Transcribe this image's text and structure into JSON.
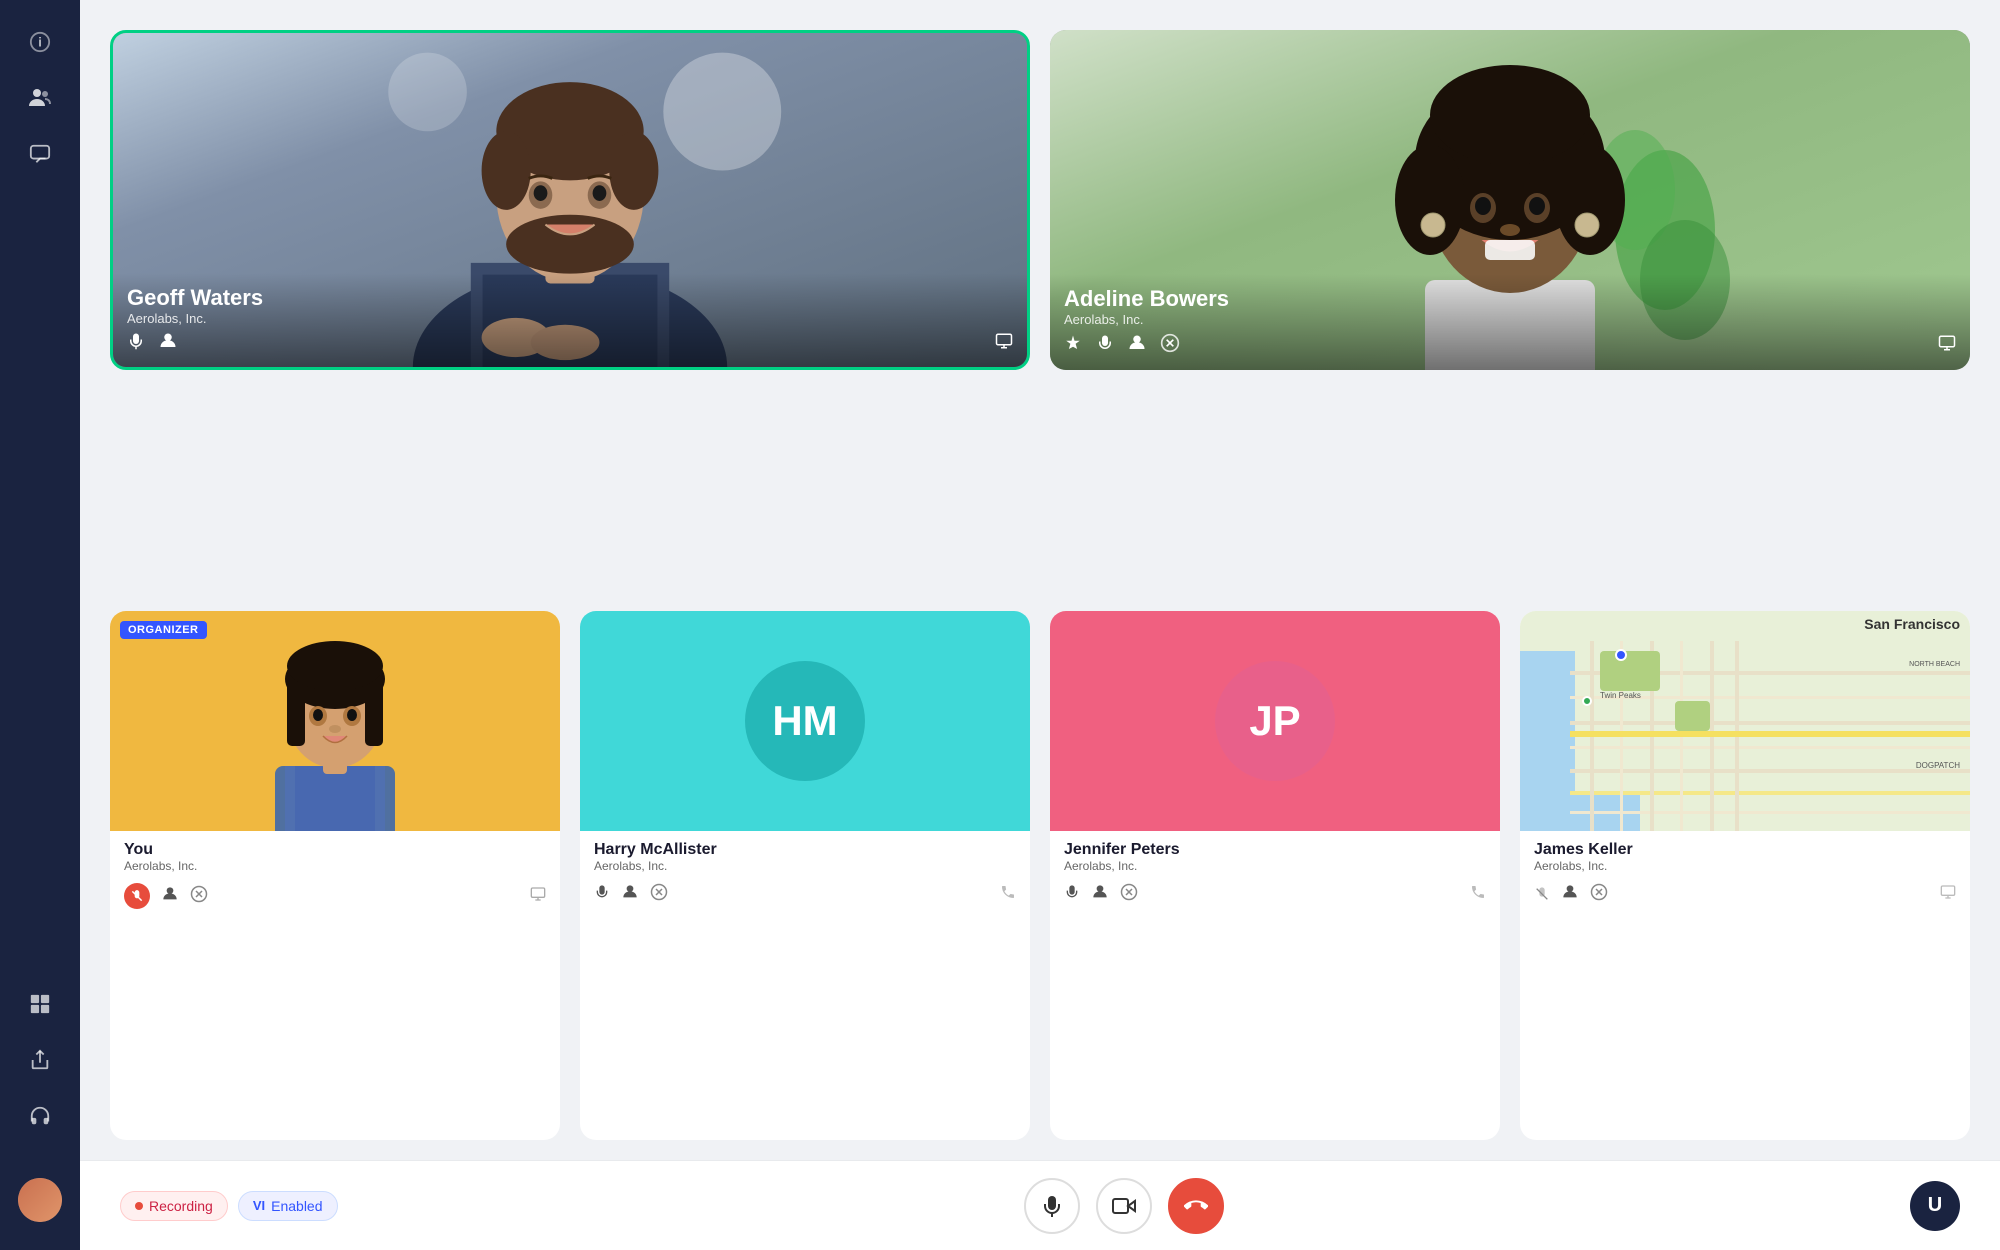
{
  "sidebar": {
    "icons": [
      {
        "name": "info-icon",
        "symbol": "ℹ",
        "active": false
      },
      {
        "name": "people-icon",
        "symbol": "👥",
        "active": false
      },
      {
        "name": "chat-icon",
        "symbol": "💬",
        "active": false
      },
      {
        "name": "grid-icon",
        "symbol": "⊞",
        "active": false
      },
      {
        "name": "share-icon",
        "symbol": "⬡",
        "active": false
      },
      {
        "name": "headset-icon",
        "symbol": "🎧",
        "active": false
      }
    ],
    "user_initials": "U"
  },
  "participants": {
    "large": [
      {
        "id": "geoff",
        "name": "Geoff Waters",
        "org": "Aerolabs, Inc.",
        "active_speaker": true,
        "controls": [
          "mic",
          "person",
          "screen"
        ]
      },
      {
        "id": "adeline",
        "name": "Adeline Bowers",
        "org": "Aerolabs, Inc.",
        "active_speaker": false,
        "controls": [
          "pin",
          "mic",
          "person",
          "close",
          "screen"
        ]
      }
    ],
    "small": [
      {
        "id": "you",
        "name": "You",
        "org": "Aerolabs, Inc.",
        "is_organizer": true,
        "controls": [
          "mic_muted",
          "person",
          "close",
          "screen"
        ]
      },
      {
        "id": "harry",
        "name": "Harry McAllister",
        "org": "Aerolabs, Inc.",
        "initials": "HM",
        "initials_class": "hm",
        "controls": [
          "mic",
          "person",
          "close",
          "phone"
        ]
      },
      {
        "id": "jennifer",
        "name": "Jennifer Peters",
        "org": "Aerolabs, Inc.",
        "initials": "JP",
        "initials_class": "jp",
        "controls": [
          "mic",
          "person",
          "close",
          "phone"
        ]
      },
      {
        "id": "james",
        "name": "James Keller",
        "org": "Aerolabs, Inc.",
        "is_map": true,
        "controls": [
          "mic_muted",
          "person",
          "close",
          "screen"
        ]
      }
    ]
  },
  "bottom_bar": {
    "badges": [
      {
        "id": "recording",
        "label": "Recording",
        "type": "recording"
      },
      {
        "id": "vi-enabled",
        "label": "VI Enabled",
        "type": "vi"
      }
    ],
    "controls": [
      {
        "id": "mic",
        "symbol": "🎤",
        "type": "normal"
      },
      {
        "id": "camera",
        "symbol": "📷",
        "type": "normal"
      },
      {
        "id": "end",
        "symbol": "📞",
        "type": "end"
      }
    ],
    "user_button_label": "U"
  }
}
